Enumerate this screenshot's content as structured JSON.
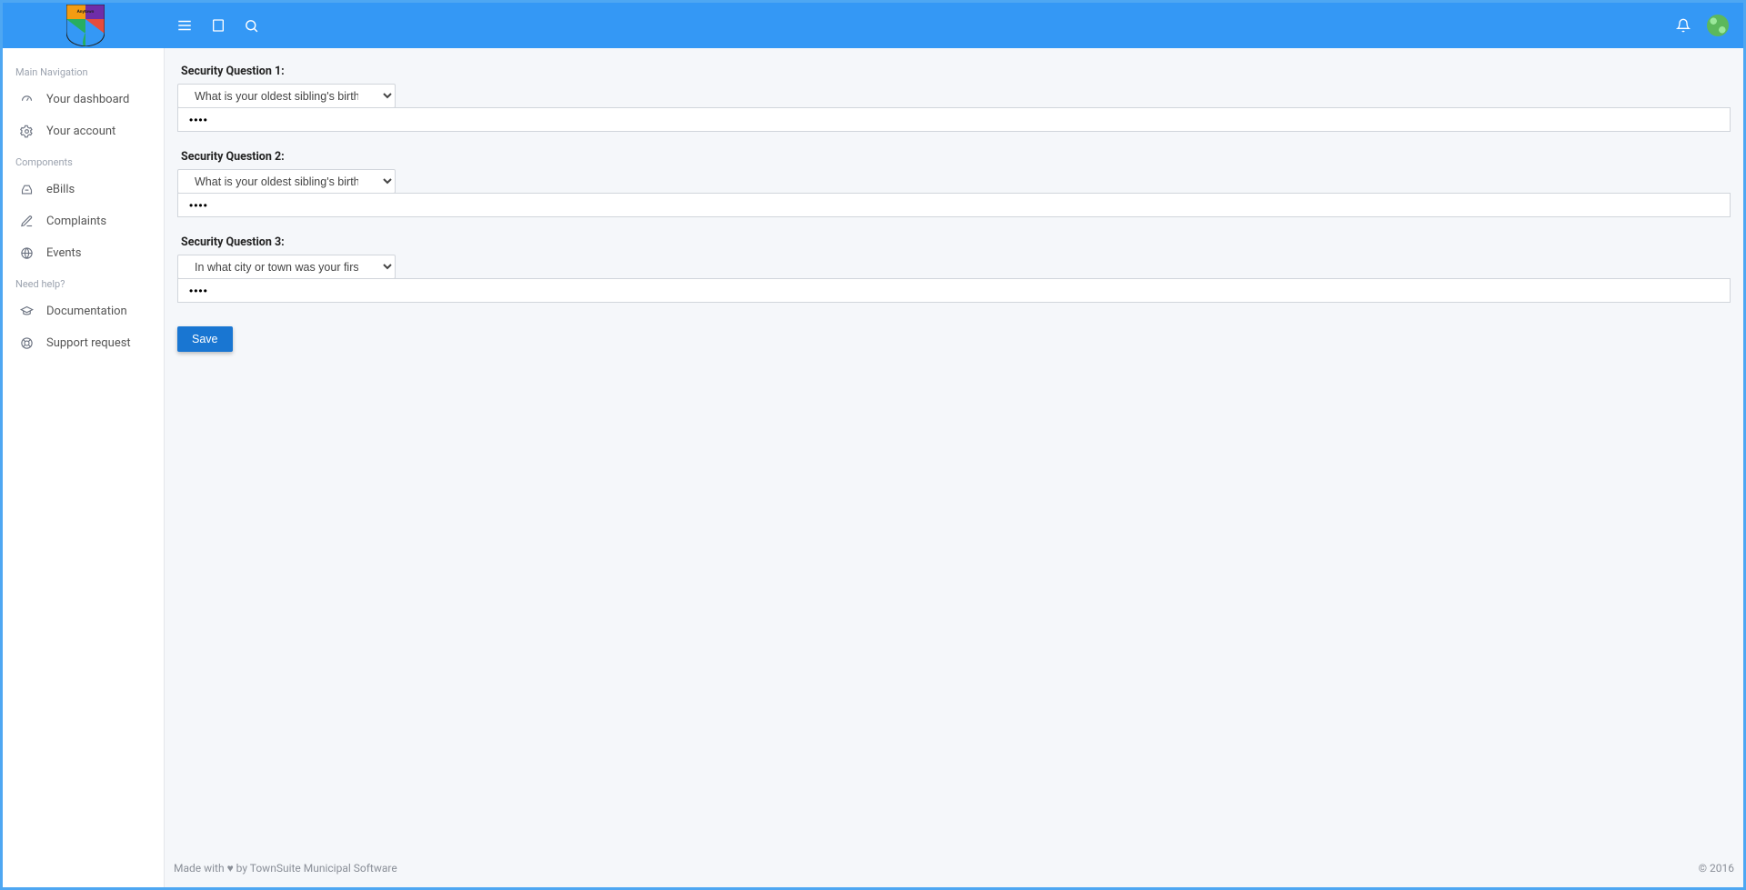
{
  "sidebar": {
    "heading_main": "Main Navigation",
    "heading_components": "Components",
    "heading_help": "Need help?",
    "items": {
      "dashboard": "Your dashboard",
      "account": "Your account",
      "ebills": "eBills",
      "complaints": "Complaints",
      "events": "Events",
      "documentation": "Documentation",
      "support": "Support request"
    }
  },
  "form": {
    "q1": {
      "label": "Security Question 1:",
      "selected": "What is your oldest sibling's birthday month and year?",
      "answer": "••••"
    },
    "q2": {
      "label": "Security Question 2:",
      "selected": "What is your oldest sibling's birthday month and year?",
      "answer": "••••"
    },
    "q3": {
      "label": "Security Question 3:",
      "selected": "In what city or town was your first job?",
      "answer": "••••"
    },
    "save": "Save"
  },
  "footer": {
    "left_a": "Made with ",
    "left_b": " by TownSuite Municipal Software",
    "right": "© 2016"
  }
}
